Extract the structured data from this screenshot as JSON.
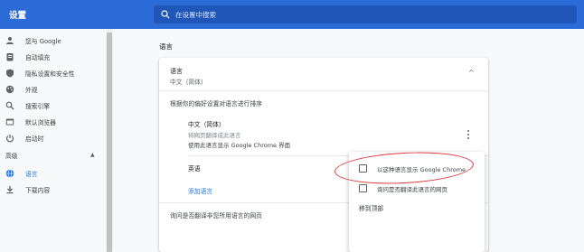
{
  "header": {
    "title": "设置",
    "search_placeholder": "在设置中搜索"
  },
  "sidebar": {
    "items": [
      {
        "label": "您与 Google",
        "icon": "person-icon"
      },
      {
        "label": "自动填充",
        "icon": "clipboard-icon"
      },
      {
        "label": "隐私设置和安全性",
        "icon": "shield-icon"
      },
      {
        "label": "外观",
        "icon": "palette-icon"
      },
      {
        "label": "搜索引擎",
        "icon": "search-icon"
      },
      {
        "label": "默认浏览器",
        "icon": "browser-icon"
      },
      {
        "label": "启动时",
        "icon": "power-icon"
      }
    ],
    "advanced_section": "高级",
    "advanced_items": [
      {
        "label": "语言",
        "icon": "globe-icon",
        "active": true
      },
      {
        "label": "下载内容",
        "icon": "download-icon"
      }
    ]
  },
  "main": {
    "section_heading": "语言",
    "language_card": {
      "title": "语言",
      "subtitle": "中文（简体）",
      "order_instruction": "根据你的偏好设置对语言进行排序",
      "languages": [
        {
          "name": "中文（简体）",
          "note": "将网页翻译成此语言",
          "display_note": "使用此语言显示 Google Chrome 界面"
        },
        {
          "name": "英语"
        }
      ],
      "add_language": "添加语言",
      "ask_translate": "询问是否翻译非您所用语言的网页"
    },
    "menu": {
      "items": [
        {
          "label": "以这种语言显示 Google Chrome",
          "checked": false
        },
        {
          "label": "询问是否翻译此语言的网页",
          "checked": false
        }
      ],
      "move_to_top": "移到顶部"
    }
  },
  "colors": {
    "header_bg": "#2b6bd8",
    "accent": "#1a73e8",
    "highlight": "#d9383a"
  }
}
